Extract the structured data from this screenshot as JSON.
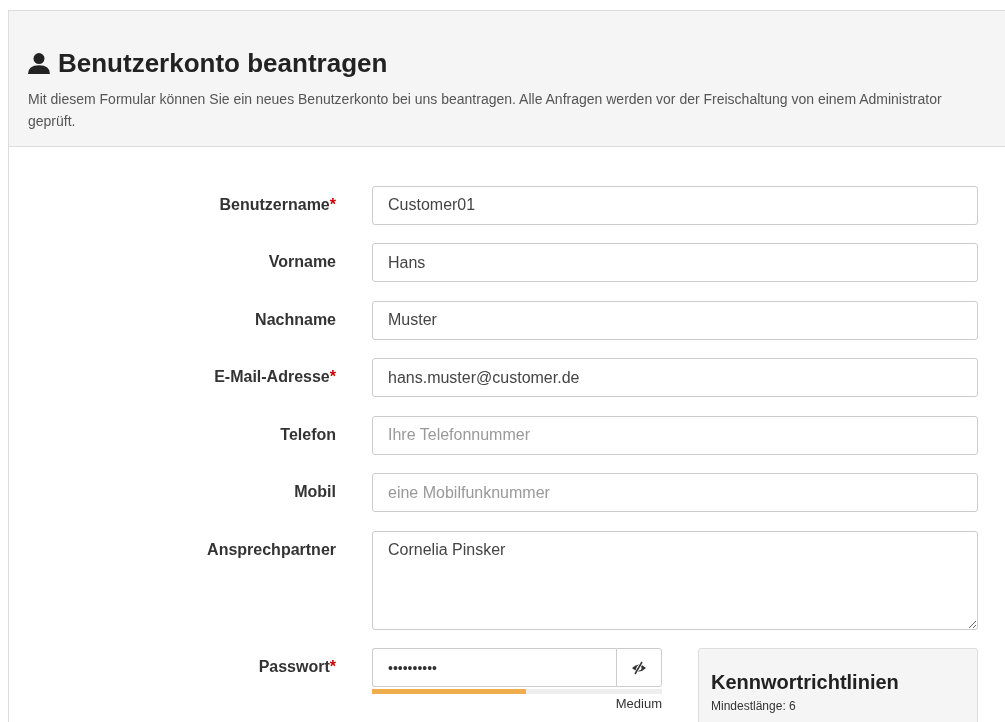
{
  "header": {
    "title": "Benutzerkonto beantragen",
    "description": "Mit diesem Formular können Sie ein neues Benutzerkonto bei uns beantragen. Alle Anfragen werden vor der Freischaltung von einem Administrator geprüft."
  },
  "fields": [
    {
      "kind": "text",
      "label": "Benutzername",
      "required_mark": "*",
      "value": "Customer01"
    },
    {
      "kind": "text",
      "label": "Vorname",
      "value": "Hans"
    },
    {
      "kind": "text",
      "label": "Nachname",
      "value": "Muster"
    },
    {
      "kind": "text",
      "label": "E-Mail-Adresse",
      "required_mark": "*",
      "value": "hans.muster@customer.de"
    },
    {
      "kind": "text",
      "label": "Telefon",
      "placeholder": "Ihre Telefonnummer"
    },
    {
      "kind": "text",
      "label": "Mobil",
      "placeholder": "eine Mobilfunknummer"
    },
    {
      "kind": "textarea",
      "label": "Ansprechpartner",
      "value": "Cornelia Pinsker"
    },
    {
      "kind": "password",
      "label": "Passwort",
      "required_mark": "*",
      "value": "••••••••••",
      "strength": {
        "level": 0.53,
        "label": "Medium"
      }
    }
  ],
  "password_policy": {
    "title": "Kennwortrichtlinien",
    "items": [
      "Mindestlänge: 6"
    ]
  }
}
